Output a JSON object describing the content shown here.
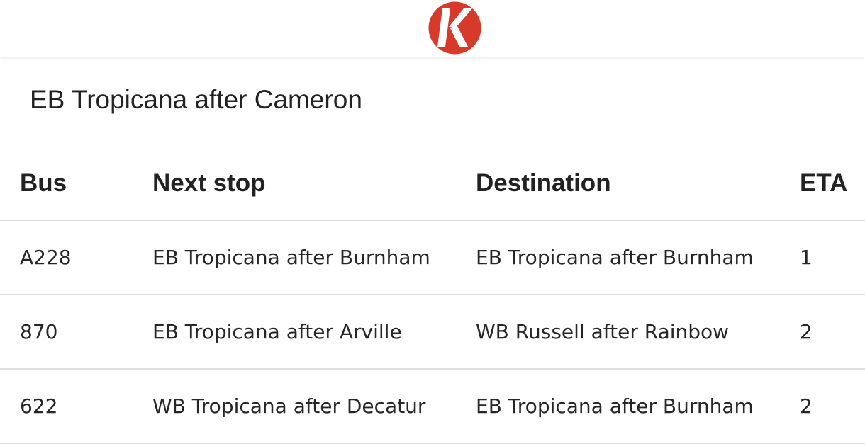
{
  "header": {
    "logo_letter": "K",
    "logo_icon": "k-logo-icon",
    "brand_color": "#d7392b"
  },
  "stop": {
    "title": "EB Tropicana after Cameron"
  },
  "table": {
    "columns": [
      "Bus",
      "Next stop",
      "Destination",
      "ETA"
    ],
    "rows": [
      {
        "bus": "A228",
        "next_stop": "EB Tropicana after Burnham",
        "destination": "EB Tropicana after Burnham",
        "eta": "1"
      },
      {
        "bus": "870",
        "next_stop": "EB Tropicana after Arville",
        "destination": "WB Russell after Rainbow",
        "eta": "2"
      },
      {
        "bus": "622",
        "next_stop": "WB Tropicana after Decatur",
        "destination": "EB Tropicana after Burnham",
        "eta": "2"
      }
    ]
  }
}
